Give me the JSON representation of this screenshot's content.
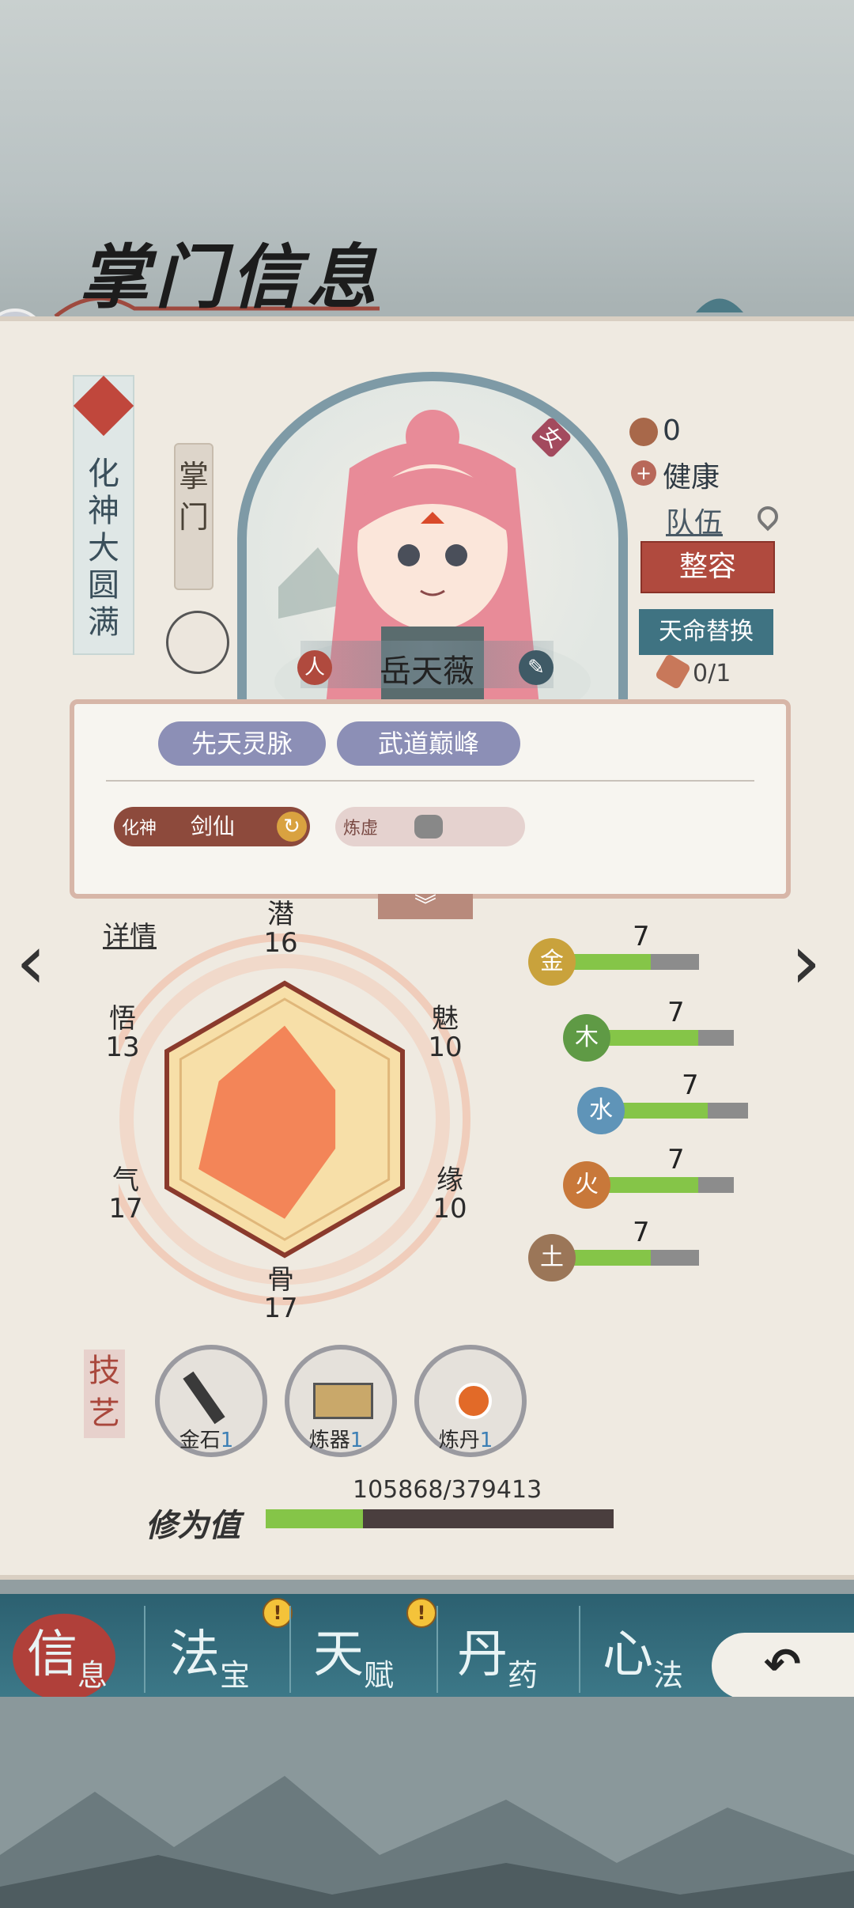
{
  "title": "掌门信息",
  "realm": "化神大圆满",
  "role": "掌门",
  "character": {
    "name": "岳天薇",
    "gender": "女",
    "race": "人",
    "badge_count": "0",
    "health": "健康",
    "team_label": "队伍"
  },
  "buttons": {
    "appearance": "整容",
    "destiny_swap": "天命替换",
    "destiny_count": "0/1"
  },
  "traits": [
    "先天灵脉",
    "武道巅峰"
  ],
  "skills": {
    "primary": {
      "tier": "化神",
      "name": "剑仙"
    },
    "secondary": {
      "tier": "炼虚",
      "name": ""
    }
  },
  "details_link": "详情",
  "attributes": {
    "潜": "16",
    "魅": "10",
    "缘": "10",
    "骨": "17",
    "气": "17",
    "悟": "13"
  },
  "attributes_max": 20,
  "elements": [
    {
      "glyph": "金",
      "value": "7",
      "fraction": 0.62,
      "color": "#c9a23c"
    },
    {
      "glyph": "木",
      "value": "7",
      "fraction": 0.72,
      "color": "#5f9a45"
    },
    {
      "glyph": "水",
      "value": "7",
      "fraction": 0.68,
      "color": "#5f94b8"
    },
    {
      "glyph": "火",
      "value": "7",
      "fraction": 0.72,
      "color": "#c8783a"
    },
    {
      "glyph": "土",
      "value": "7",
      "fraction": 0.62,
      "color": "#9b7658"
    }
  ],
  "crafts_label": "技艺",
  "crafts": [
    {
      "name": "金石",
      "level": "1"
    },
    {
      "name": "炼器",
      "level": "1"
    },
    {
      "name": "炼丹",
      "level": "1"
    }
  ],
  "cultivation": {
    "label": "修为值",
    "value": "105868/379413",
    "fraction": 0.279
  },
  "tabs": [
    {
      "big": "信",
      "small": "息",
      "active": true
    },
    {
      "big": "法",
      "small": "宝",
      "alert": true
    },
    {
      "big": "天",
      "small": "赋",
      "alert": true
    },
    {
      "big": "丹",
      "small": "药"
    },
    {
      "big": "心",
      "small": "法"
    }
  ],
  "colors": {
    "accent_red": "#b04a3e",
    "accent_teal": "#3f7382",
    "radar_fill": "#f27b4f"
  }
}
